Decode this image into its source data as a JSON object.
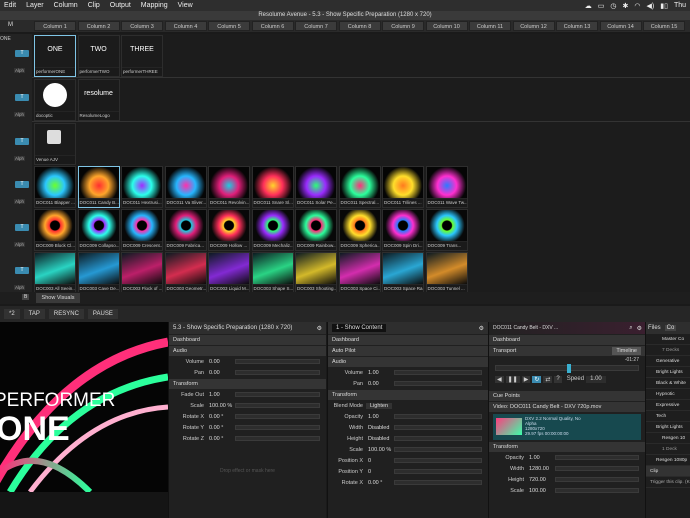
{
  "menubar": {
    "items": [
      "Edit",
      "Layer",
      "Column",
      "Clip",
      "Output",
      "Mapping",
      "View"
    ],
    "right_text": "Thu"
  },
  "window": {
    "title": "Resolume Avenue - 5.3 - Show Specific Preparation (1280 x 720)"
  },
  "left_header": {
    "m": "M"
  },
  "columns": [
    "Column 1",
    "Column 2",
    "Column 3",
    "Column 4",
    "Column 5",
    "Column 6",
    "Column 7",
    "Column 8",
    "Column 9",
    "Column 10",
    "Column 11",
    "Column 12",
    "Column 13",
    "Column 14",
    "Column 15"
  ],
  "layers": [
    {
      "t": "T",
      "a": "Alph",
      "left_text": "ONE",
      "clips": [
        "performerONE",
        "performerTWO",
        "performerTHREE"
      ],
      "thumbs": [
        "ONE",
        "TWO",
        "THREE"
      ]
    },
    {
      "t": "T",
      "a": "Alph",
      "clips": [
        "docoptic",
        "ResolumeLogo"
      ],
      "thumbs": [
        "",
        "resolume"
      ]
    },
    {
      "t": "T",
      "a": "Alph",
      "clips": [
        "Venue AJV"
      ]
    },
    {
      "t": "T",
      "a": "Alph",
      "clips": [
        "DOC011 Blapper ...",
        "DOC011 Candy B...",
        "DOC011 Hextrusi...",
        "DOC011 Va Sliver...",
        "DOC011 Revolvin...",
        "DOC011 Snare Sl...",
        "DOC011 Solar Pe...",
        "DOC011 Spectral...",
        "DOC011 Trilines ...",
        "DOC011 Wave Tw..."
      ]
    },
    {
      "t": "T",
      "a": "Alph",
      "clips": [
        "DOC009 Block Cl...",
        "DOC009 Collapso...",
        "DOC009 Crescent...",
        "DOC009 Fabrica...",
        "DOC009 Hollow ...",
        "DOC009 Mechaliz...",
        "DOC009 Rainbow...",
        "DOC009 Spherica...",
        "DOC009 Spin Dri...",
        "DOC009 Trans..."
      ]
    },
    {
      "t": "T",
      "a": "Alph",
      "clips": [
        "DOC003 All Seein...",
        "DOC003 Cave De...",
        "DOC003 Flock of ...",
        "DOC003 Geometr...",
        "DOC003 Liquid M...",
        "DOC003 Shape S...",
        "DOC003 Shooting...",
        "DOC003 Space Ci...",
        "DOC003 Space Ra...",
        "DOC003 Tunnel ..."
      ]
    }
  ],
  "deck_row": {
    "b": "B",
    "tab": "Show Visuals"
  },
  "transport": {
    "buttons": [
      "*2",
      "TAP",
      "RESYNC",
      "PAUSE"
    ]
  },
  "preview": {
    "line1": "PERFORMER",
    "line2": "ONE"
  },
  "comp_panel": {
    "title": "5.3 - Show Specific Preparation (1280 x 720)",
    "sections": {
      "dashboard": "Dashboard",
      "audio": "Audio",
      "transform": "Transform"
    },
    "audio": [
      {
        "k": "Volume",
        "v": "0.00"
      },
      {
        "k": "Pan",
        "v": "0.00"
      }
    ],
    "transform": [
      {
        "k": "Fade Out",
        "v": "1.00"
      },
      {
        "k": "Scale",
        "v": "100.00 %"
      },
      {
        "k": "Rotate X",
        "v": "0.00 °"
      },
      {
        "k": "Rotate Y",
        "v": "0.00 °"
      },
      {
        "k": "Rotate Z",
        "v": "0.00 °"
      }
    ],
    "drop_hint": "Drop effect or mask here"
  },
  "layer_panel": {
    "title": "1 - Show Content",
    "sections": {
      "dashboard": "Dashboard",
      "autopilot": "Auto Pilot",
      "audio": "Audio",
      "transform": "Transform"
    },
    "audio": [
      {
        "k": "Volume",
        "v": "1.00"
      },
      {
        "k": "Pan",
        "v": "0.00"
      }
    ],
    "blend": {
      "k": "Blend Mode",
      "v": "Lighten"
    },
    "transform": [
      {
        "k": "Opacity",
        "v": "1.00"
      },
      {
        "k": "Width",
        "v": "Disabled"
      },
      {
        "k": "Height",
        "v": "Disabled"
      },
      {
        "k": "Scale",
        "v": "100.00 %"
      },
      {
        "k": "Position X",
        "v": "0"
      },
      {
        "k": "Position Y",
        "v": "0"
      },
      {
        "k": "Rotate X",
        "v": "0.00 °"
      }
    ]
  },
  "clip_panel": {
    "title": "DOC011 Candy Belt - DXV ...",
    "sections": {
      "dashboard": "Dashboard",
      "transport": "Transport",
      "cue": "Cue Points",
      "transform": "Transform"
    },
    "timeline_label": "Timeline",
    "time": "-01:27",
    "speed_label": "Speed",
    "speed_value": "1.00",
    "video_title": "Video: DOC011 Candy Belt - DXV 720p.mov",
    "video_info": [
      "DXV 2.2 Normal Quality, No",
      "Alpha",
      "1280x720",
      "29.97 fps 00:00:00:00"
    ],
    "transform": [
      {
        "k": "Opacity",
        "v": "1.00"
      },
      {
        "k": "Width",
        "v": "1280.00"
      },
      {
        "k": "Height",
        "v": "720.00"
      },
      {
        "k": "Scale",
        "v": "100.00"
      }
    ]
  },
  "files_panel": {
    "tabs": [
      "Files",
      "Co"
    ],
    "master": "Master Co",
    "decks_label": "7 Decks",
    "items": [
      "Generative",
      "Bright Lights",
      "Black & White",
      "Hypnotic",
      "Expressive",
      "Tech",
      "Bright Lights"
    ],
    "resgen": "Resgen 10",
    "deck_count": "1 Deck",
    "item2": "Resgen 1080p",
    "clip_label": "Clip",
    "clip_hint": "Trigger this clip. (K"
  },
  "colors": {
    "accent": "#3a8bb0",
    "select": "#7fc5e6"
  }
}
